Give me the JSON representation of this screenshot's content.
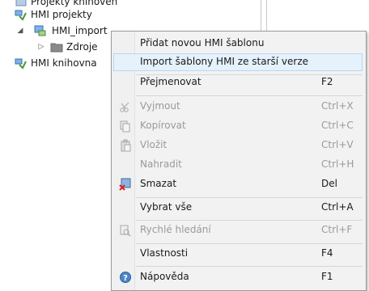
{
  "tree": {
    "clipped_item": "Projekty knihoven",
    "hmi_projekty": "HMI projekty",
    "hmi_import": "HMI_import",
    "zdroje": "Zdroje",
    "hmi_knihovna": "HMI knihovna"
  },
  "menu": {
    "items": [
      {
        "label": "Přidat novou HMI šablonu",
        "shortcut": "",
        "icon": "none",
        "disabled": false
      },
      {
        "label": "Import šablony HMI ze starší verze",
        "shortcut": "",
        "icon": "none",
        "disabled": false,
        "highlighted": true
      },
      {
        "label": "Přejmenovat",
        "shortcut": "F2",
        "icon": "none",
        "disabled": false
      },
      {
        "label": "Vyjmout",
        "shortcut": "Ctrl+X",
        "icon": "scissors-icon",
        "disabled": true
      },
      {
        "label": "Kopírovat",
        "shortcut": "Ctrl+C",
        "icon": "copy-icon",
        "disabled": true
      },
      {
        "label": "Vložit",
        "shortcut": "Ctrl+V",
        "icon": "paste-icon",
        "disabled": true
      },
      {
        "label": "Nahradit",
        "shortcut": "Ctrl+H",
        "icon": "none",
        "disabled": true
      },
      {
        "label": "Smazat",
        "shortcut": "Del",
        "icon": "delete-icon",
        "disabled": false
      },
      {
        "label": "Vybrat vše",
        "shortcut": "Ctrl+A",
        "icon": "none",
        "disabled": false
      },
      {
        "label": "Rychlé hledání",
        "shortcut": "Ctrl+F",
        "icon": "quick-search-icon",
        "disabled": true
      },
      {
        "label": "Vlastnosti",
        "shortcut": "F4",
        "icon": "none",
        "disabled": false
      },
      {
        "label": "Nápověda",
        "shortcut": "F1",
        "icon": "help-icon",
        "disabled": false
      }
    ]
  },
  "colors": {
    "highlight_bg": "#e5f1fb",
    "highlight_border": "#b6d7f2",
    "disabled_text": "#9a9a9a",
    "menu_bg": "#f2f2f2"
  }
}
